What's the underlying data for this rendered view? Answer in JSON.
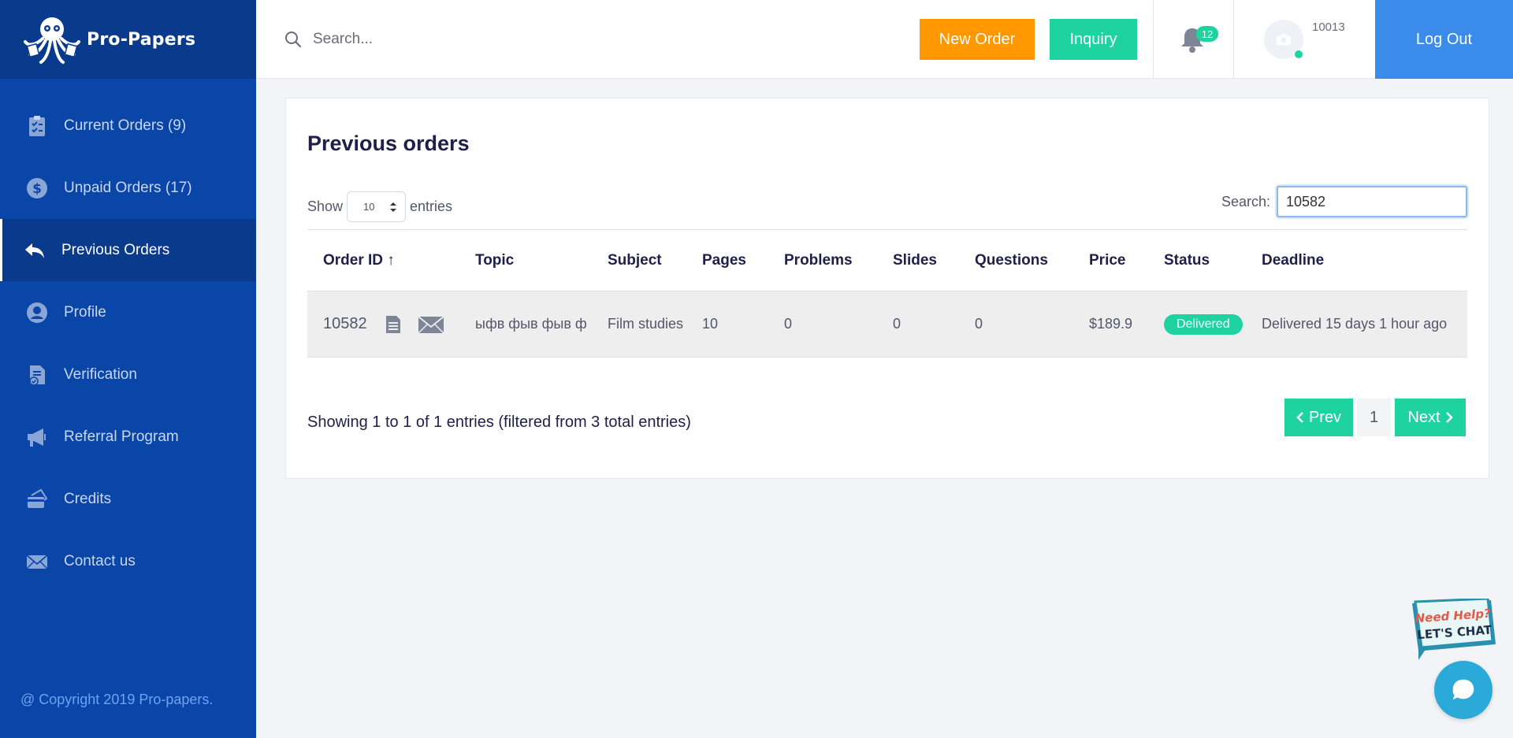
{
  "brand": {
    "name": "Pro-Papers"
  },
  "sidebar": {
    "items": [
      {
        "label": "Current Orders (9)",
        "icon": "clipboard-check-icon",
        "active": false
      },
      {
        "label": "Unpaid Orders (17)",
        "icon": "dollar-circle-icon",
        "active": false
      },
      {
        "label": "Previous Orders",
        "icon": "reply-arrow-icon",
        "active": true
      },
      {
        "label": "Profile",
        "icon": "user-circle-icon",
        "active": false
      },
      {
        "label": "Verification",
        "icon": "document-check-icon",
        "active": false
      },
      {
        "label": "Referral Program",
        "icon": "megaphone-icon",
        "active": false
      },
      {
        "label": "Credits",
        "icon": "credit-card-icon",
        "active": false
      },
      {
        "label": "Contact us",
        "icon": "envelope-icon",
        "active": false
      }
    ],
    "copyright": "@ Copyright 2019 Pro-papers."
  },
  "topbar": {
    "search_placeholder": "Search...",
    "new_order_label": "New Order",
    "inquiry_label": "Inquiry",
    "notification_count": "12",
    "user_id": "10013",
    "logout_label": "Log Out"
  },
  "main": {
    "title": "Previous orders",
    "show_label": "Show",
    "entries_value": "10",
    "entries_label": "entries",
    "search_label": "Search:",
    "search_value": "10582",
    "columns": [
      "Order ID ↑",
      "Topic",
      "Subject",
      "Pages",
      "Problems",
      "Slides",
      "Questions",
      "Price",
      "Status",
      "Deadline"
    ],
    "rows": [
      {
        "order_id": "10582",
        "topic": "ыфв фыв фыв ф",
        "subject": "Film studies",
        "pages": "10",
        "problems": "0",
        "slides": "0",
        "questions": "0",
        "price": "$189.9",
        "status": "Delivered",
        "deadline": "Delivered 15 days 1 hour ago"
      }
    ],
    "summary": "Showing 1 to 1 of 1 entries (filtered from 3 total entries)",
    "pagination": {
      "prev_label": "Prev",
      "current_page": "1",
      "next_label": "Next"
    }
  },
  "chat": {
    "sign_line1": "Need Help?",
    "sign_line2": "LET'S CHAT"
  },
  "colors": {
    "sidebar_bg": "#0a46a8",
    "sidebar_dark": "#0a3a8c",
    "accent_green": "#1fd3a0",
    "accent_orange": "#ff9800",
    "logout_blue": "#3a8bea",
    "chat_blue": "#2ba9d8"
  }
}
